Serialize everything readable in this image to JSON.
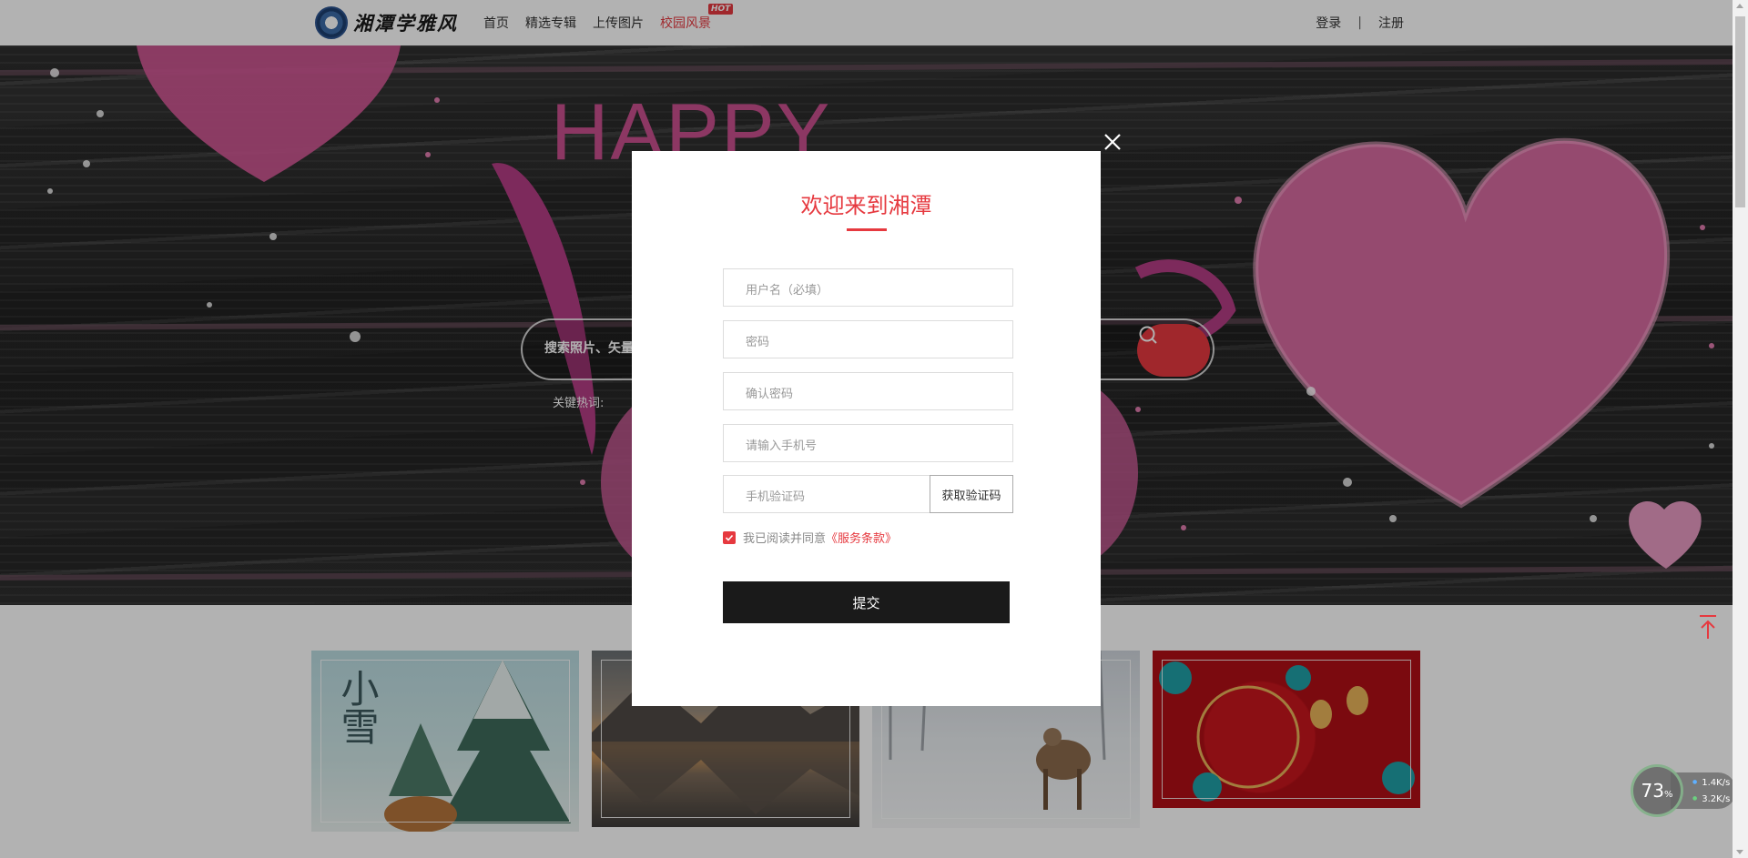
{
  "header": {
    "logo_text": "湘潭学雅风",
    "nav": [
      {
        "label": "首页"
      },
      {
        "label": "精选专辑"
      },
      {
        "label": "上传图片"
      },
      {
        "label": "校园风景",
        "badge": "HOT"
      }
    ],
    "login": "登录",
    "separator": "|",
    "register": "注册"
  },
  "banner": {
    "headline_top": "HAPPY",
    "search_placeholder": "搜索照片、矢量",
    "hot_keywords_label": "关键热词:"
  },
  "modal": {
    "title": "欢迎来到湘潭",
    "fields": {
      "username": "用户名（必填）",
      "password": "密码",
      "confirm_password": "确认密码",
      "phone": "请输入手机号",
      "sms_code": "手机验证码"
    },
    "get_code_button": "获取验证码",
    "agree_text": "我已阅读并同意",
    "terms_link": "《服务条款》",
    "submit_label": "提交"
  },
  "gallery": {
    "thumb1_caption": "小雪"
  },
  "net_monitor": {
    "percent": "73",
    "percent_unit": "%",
    "upload": "1.4K/s",
    "download": "3.2K/s"
  },
  "colors": {
    "accent": "#e6393f",
    "submit_bg": "#1a1a1a"
  }
}
